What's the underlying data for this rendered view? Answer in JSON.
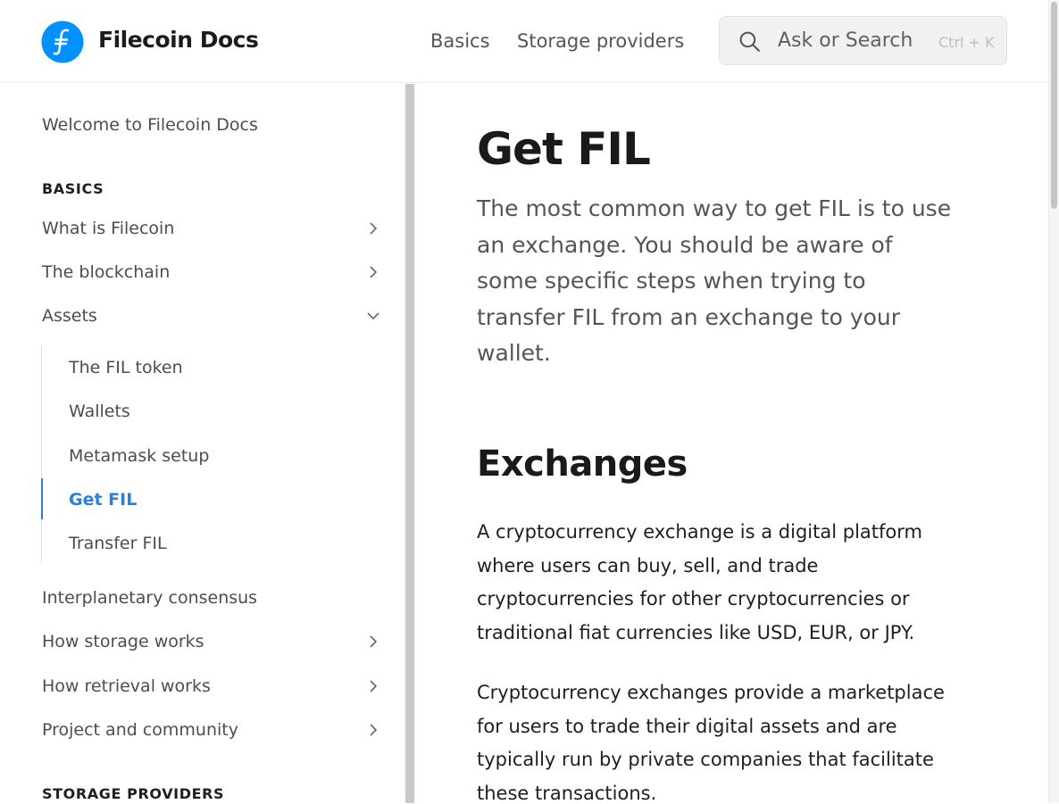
{
  "header": {
    "brand": "Filecoin Docs",
    "nav": [
      "Basics",
      "Storage providers"
    ],
    "search": {
      "placeholder": "Ask or Search",
      "shortcut": "Ctrl + K"
    }
  },
  "sidebar": {
    "welcome": "Welcome to Filecoin Docs",
    "basics_heading": "BASICS",
    "items": [
      {
        "label": "What is Filecoin",
        "chevron": "right"
      },
      {
        "label": "The blockchain",
        "chevron": "right"
      },
      {
        "label": "Assets",
        "chevron": "down"
      }
    ],
    "assets_children": [
      "The FIL token",
      "Wallets",
      "Metamask setup",
      "Get FIL",
      "Transfer FIL"
    ],
    "active_child": "Get FIL",
    "more_items": [
      {
        "label": "Interplanetary consensus",
        "chevron": ""
      },
      {
        "label": "How storage works",
        "chevron": "right"
      },
      {
        "label": "How retrieval works",
        "chevron": "right"
      },
      {
        "label": "Project and community",
        "chevron": "right"
      }
    ],
    "storage_heading": "STORAGE PROVIDERS"
  },
  "content": {
    "title": "Get FIL",
    "lead": "The most common way to get FIL is to use an exchange. You should be aware of some specific steps when trying to transfer FIL from an exchange to your wallet.",
    "section_title": "Exchanges",
    "paragraphs": [
      "A cryptocurrency exchange is a digital platform where users can buy, sell, and trade cryptocurrencies for other cryptocurrencies or traditional fiat currencies like USD, EUR, or JPY.",
      "Cryptocurrency exchanges provide a marketplace for users to trade their digital assets and are typically run by private companies that facilitate these transactions."
    ]
  },
  "colors": {
    "accent": "#2f7fd8",
    "logo": "#0090ff"
  },
  "icons": [
    "filecoin-logo-icon",
    "search-icon",
    "chevron-right-icon",
    "chevron-down-icon"
  ]
}
